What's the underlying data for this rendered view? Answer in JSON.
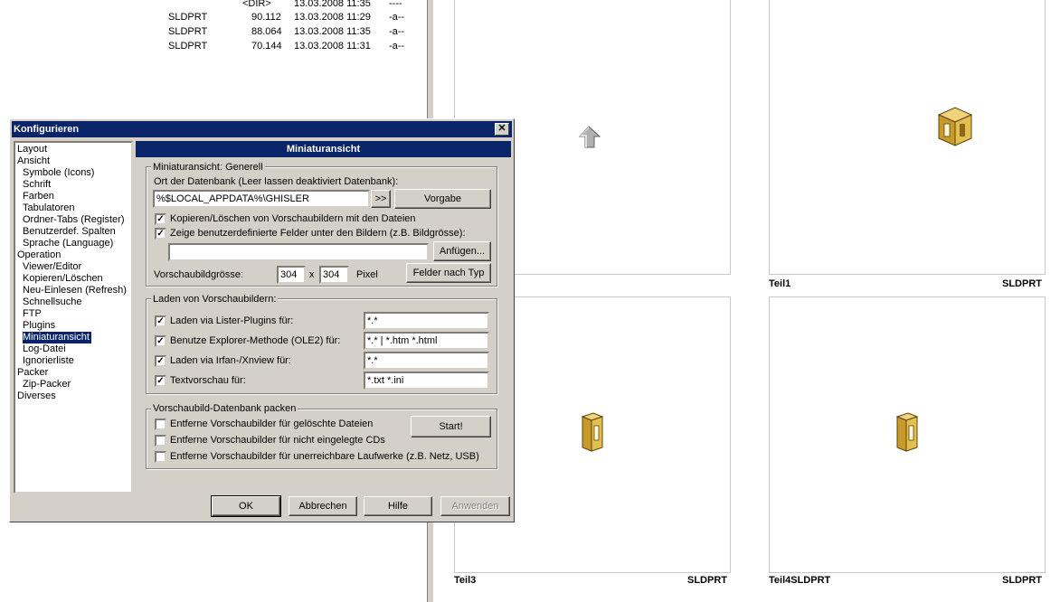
{
  "file_list": {
    "rows": [
      {
        "ext": "",
        "size": "<DIR>",
        "date": "13.03.2008 11:35",
        "attr": "----"
      },
      {
        "ext": "SLDPRT",
        "size": "90.112",
        "date": "13.03.2008 11:29",
        "attr": "-a--"
      },
      {
        "ext": "SLDPRT",
        "size": "88.064",
        "date": "13.03.2008 11:35",
        "attr": "-a--"
      },
      {
        "ext": "SLDPRT",
        "size": "70.144",
        "date": "13.03.2008 11:31",
        "attr": "-a--"
      }
    ]
  },
  "thumbnails": [
    {
      "name": "",
      "ext": "",
      "icon": "up-arrow-icon"
    },
    {
      "name": "Teil1",
      "ext": "SLDPRT",
      "icon": "part-icon"
    },
    {
      "name": "Teil3",
      "ext": "SLDPRT",
      "icon": "part-icon"
    },
    {
      "name": "Teil4SLDPRT",
      "ext": "SLDPRT",
      "icon": "part-icon"
    }
  ],
  "dialog": {
    "title": "Konfigurieren",
    "close": "✕",
    "tree": [
      {
        "label": "Layout",
        "indent": 0
      },
      {
        "label": "Ansicht",
        "indent": 0
      },
      {
        "label": "Symbole (Icons)",
        "indent": 1
      },
      {
        "label": "Schrift",
        "indent": 1
      },
      {
        "label": "Farben",
        "indent": 1
      },
      {
        "label": "Tabulatoren",
        "indent": 1
      },
      {
        "label": "Ordner-Tabs (Register)",
        "indent": 1
      },
      {
        "label": "Benutzerdef. Spalten",
        "indent": 1
      },
      {
        "label": "Sprache (Language)",
        "indent": 1
      },
      {
        "label": "Operation",
        "indent": 0
      },
      {
        "label": "Viewer/Editor",
        "indent": 1
      },
      {
        "label": "Kopieren/Löschen",
        "indent": 1
      },
      {
        "label": "Neu-Einlesen (Refresh)",
        "indent": 1
      },
      {
        "label": "Schnellsuche",
        "indent": 1
      },
      {
        "label": "FTP",
        "indent": 1
      },
      {
        "label": "Plugins",
        "indent": 1
      },
      {
        "label": "Miniaturansicht",
        "indent": 1,
        "selected": true
      },
      {
        "label": "Log-Datei",
        "indent": 1
      },
      {
        "label": "Ignorierliste",
        "indent": 1
      },
      {
        "label": "Packer",
        "indent": 0
      },
      {
        "label": "Zip-Packer",
        "indent": 1
      },
      {
        "label": "Diverses",
        "indent": 0
      }
    ],
    "panel_title": "Miniaturansicht",
    "general": {
      "group_title": "Miniaturansicht: Generell",
      "db_label": "Ort der Datenbank (Leer lassen deaktiviert Datenbank):",
      "db_value": "%$LOCAL_APPDATA%\\GHISLER",
      "browse": ">>",
      "default_btn": "Vorgabe",
      "copy_delete_label": "Kopieren/Löschen von Vorschaubildern mit den Dateien",
      "copy_delete_checked": true,
      "custom_fields_label": "Zeige benutzerdefinierte Felder unter den Bildern (z.B. Bildgrösse):",
      "custom_fields_checked": true,
      "custom_fields_value": "",
      "append_btn": "Anfügen...",
      "size_label": "Vorschaubildgrösse:",
      "width": "304",
      "x": "x",
      "height": "304",
      "unit": "Pixel",
      "fields_by_type_btn": "Felder nach Typ"
    },
    "loading": {
      "group_title": "Laden von Vorschaubildern:",
      "items": [
        {
          "label": "Laden via Lister-Plugins für:",
          "checked": true,
          "value": "*.*"
        },
        {
          "label": "Benutze Explorer-Methode (OLE2) für:",
          "checked": true,
          "value": "*.* | *.htm *.html"
        },
        {
          "label": "Laden via Irfan-/Xnview für:",
          "checked": true,
          "value": "*.*"
        },
        {
          "label": "Textvorschau für:",
          "checked": true,
          "value": "*.txt *.ini"
        }
      ]
    },
    "pack": {
      "group_title": "Vorschaubild-Datenbank packen",
      "items": [
        {
          "label": "Entferne Vorschaubilder für gelöschte Dateien",
          "checked": false
        },
        {
          "label": "Entferne Vorschaubilder für nicht eingelegte CDs",
          "checked": false
        },
        {
          "label": "Entferne Vorschaubilder für unerreichbare Laufwerke (z.B. Netz, USB)",
          "checked": false
        }
      ],
      "start_btn": "Start!"
    },
    "buttons": {
      "ok": "OK",
      "cancel": "Abbrechen",
      "help": "Hilfe",
      "apply": "Anwenden"
    }
  },
  "colors": {
    "selection": "#0a246a",
    "face": "#d4d0c8",
    "part_fill": "#e2bf4f"
  }
}
